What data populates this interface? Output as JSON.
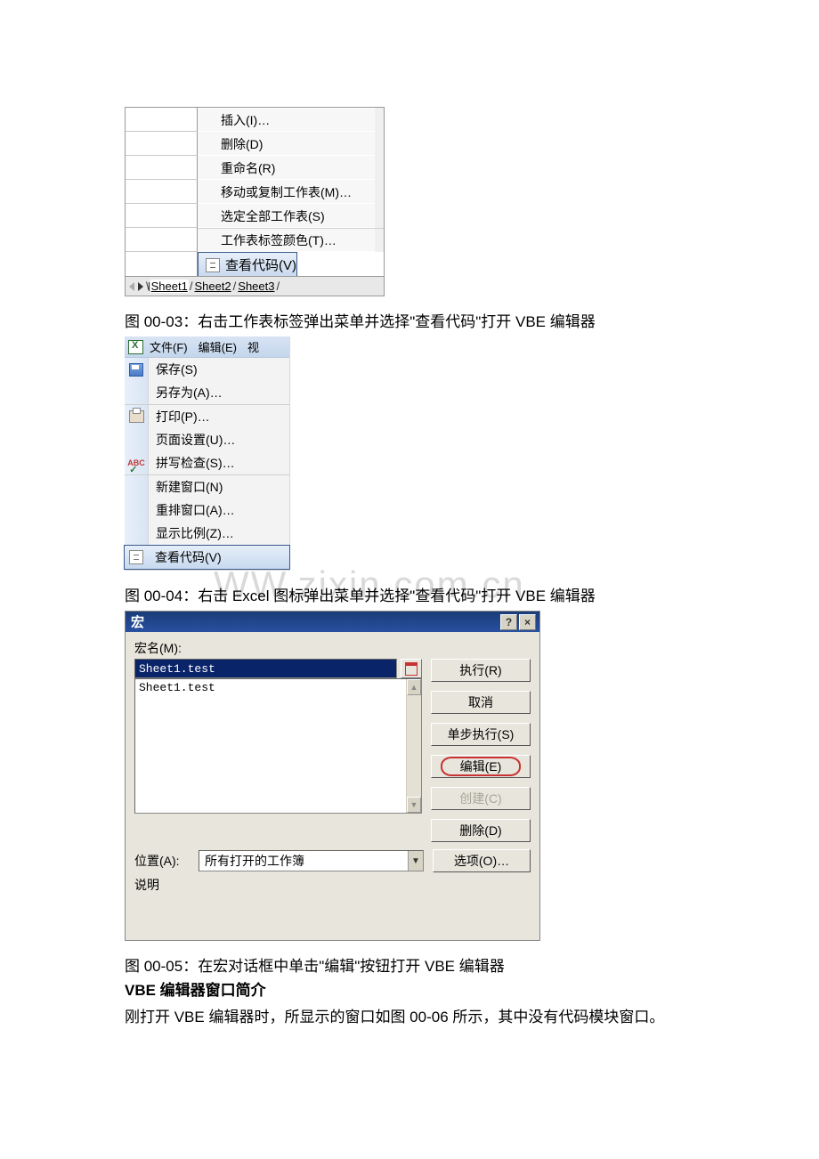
{
  "fig1": {
    "menu_items": {
      "insert": "插入(I)…",
      "delete": "删除(D)",
      "rename": "重命名(R)",
      "move_copy": "移动或复制工作表(M)…",
      "select_all": "选定全部工作表(S)",
      "tab_color": "工作表标签颜色(T)…",
      "view_code": "查看代码(V)"
    },
    "tabs": {
      "t1": "Sheet1",
      "t2": "Sheet2",
      "t3": "Sheet3"
    }
  },
  "caption1": "图 00-03：右击工作表标签弹出菜单并选择\"查看代码\"打开 VBE 编辑器",
  "fig2": {
    "topbar": {
      "file": "文件(F)",
      "edit": "编辑(E)",
      "view_frag": "视"
    },
    "items": {
      "save": "保存(S)",
      "save_as": "另存为(A)…",
      "print": "打印(P)…",
      "page_setup": "页面设置(U)…",
      "spellcheck": "拼写检查(S)…",
      "new_window": "新建窗口(N)",
      "arrange": "重排窗口(A)…",
      "zoom": "显示比例(Z)…",
      "view_code": "查看代码(V)"
    }
  },
  "caption2": "图 00-04：右击 Excel 图标弹出菜单并选择\"查看代码\"打开 VBE 编辑器",
  "watermark": "WW.zixin.com.cn",
  "fig3": {
    "title": "宏",
    "macro_name_label": "宏名(M):",
    "macro_name_value": "Sheet1.test",
    "list_item": "Sheet1.test",
    "buttons": {
      "run": "执行(R)",
      "cancel": "取消",
      "step": "单步执行(S)",
      "edit": "编辑(E)",
      "create": "创建(C)",
      "delete": "删除(D)",
      "options": "选项(O)…"
    },
    "location_label": "位置(A):",
    "location_value": "所有打开的工作簿",
    "desc_label": "说明"
  },
  "caption3": "图 00-05：在宏对话框中单击\"编辑\"按钮打开 VBE 编辑器",
  "heading": "VBE 编辑器窗口简介",
  "body": "刚打开 VBE 编辑器时，所显示的窗口如图 00-06 所示，其中没有代码模块窗口。"
}
